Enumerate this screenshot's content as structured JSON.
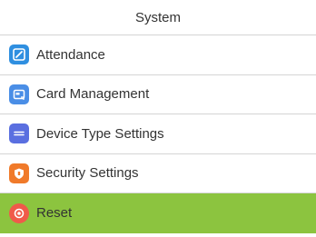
{
  "header": {
    "title": "System"
  },
  "menu": {
    "items": [
      {
        "label": "Attendance",
        "icon": "attendance-icon",
        "color": "#2f8fe0"
      },
      {
        "label": "Card Management",
        "icon": "card-management-icon",
        "color": "#4a8ee6"
      },
      {
        "label": "Device Type Settings",
        "icon": "device-type-icon",
        "color": "#5a6fe0"
      },
      {
        "label": "Security Settings",
        "icon": "shield-icon",
        "color": "#f07a2a"
      },
      {
        "label": "Reset",
        "icon": "reset-icon",
        "color": "#f05a4a",
        "selected": true
      }
    ]
  },
  "colors": {
    "selected_background": "#8cc43f",
    "divider": "#d4d4d4"
  }
}
